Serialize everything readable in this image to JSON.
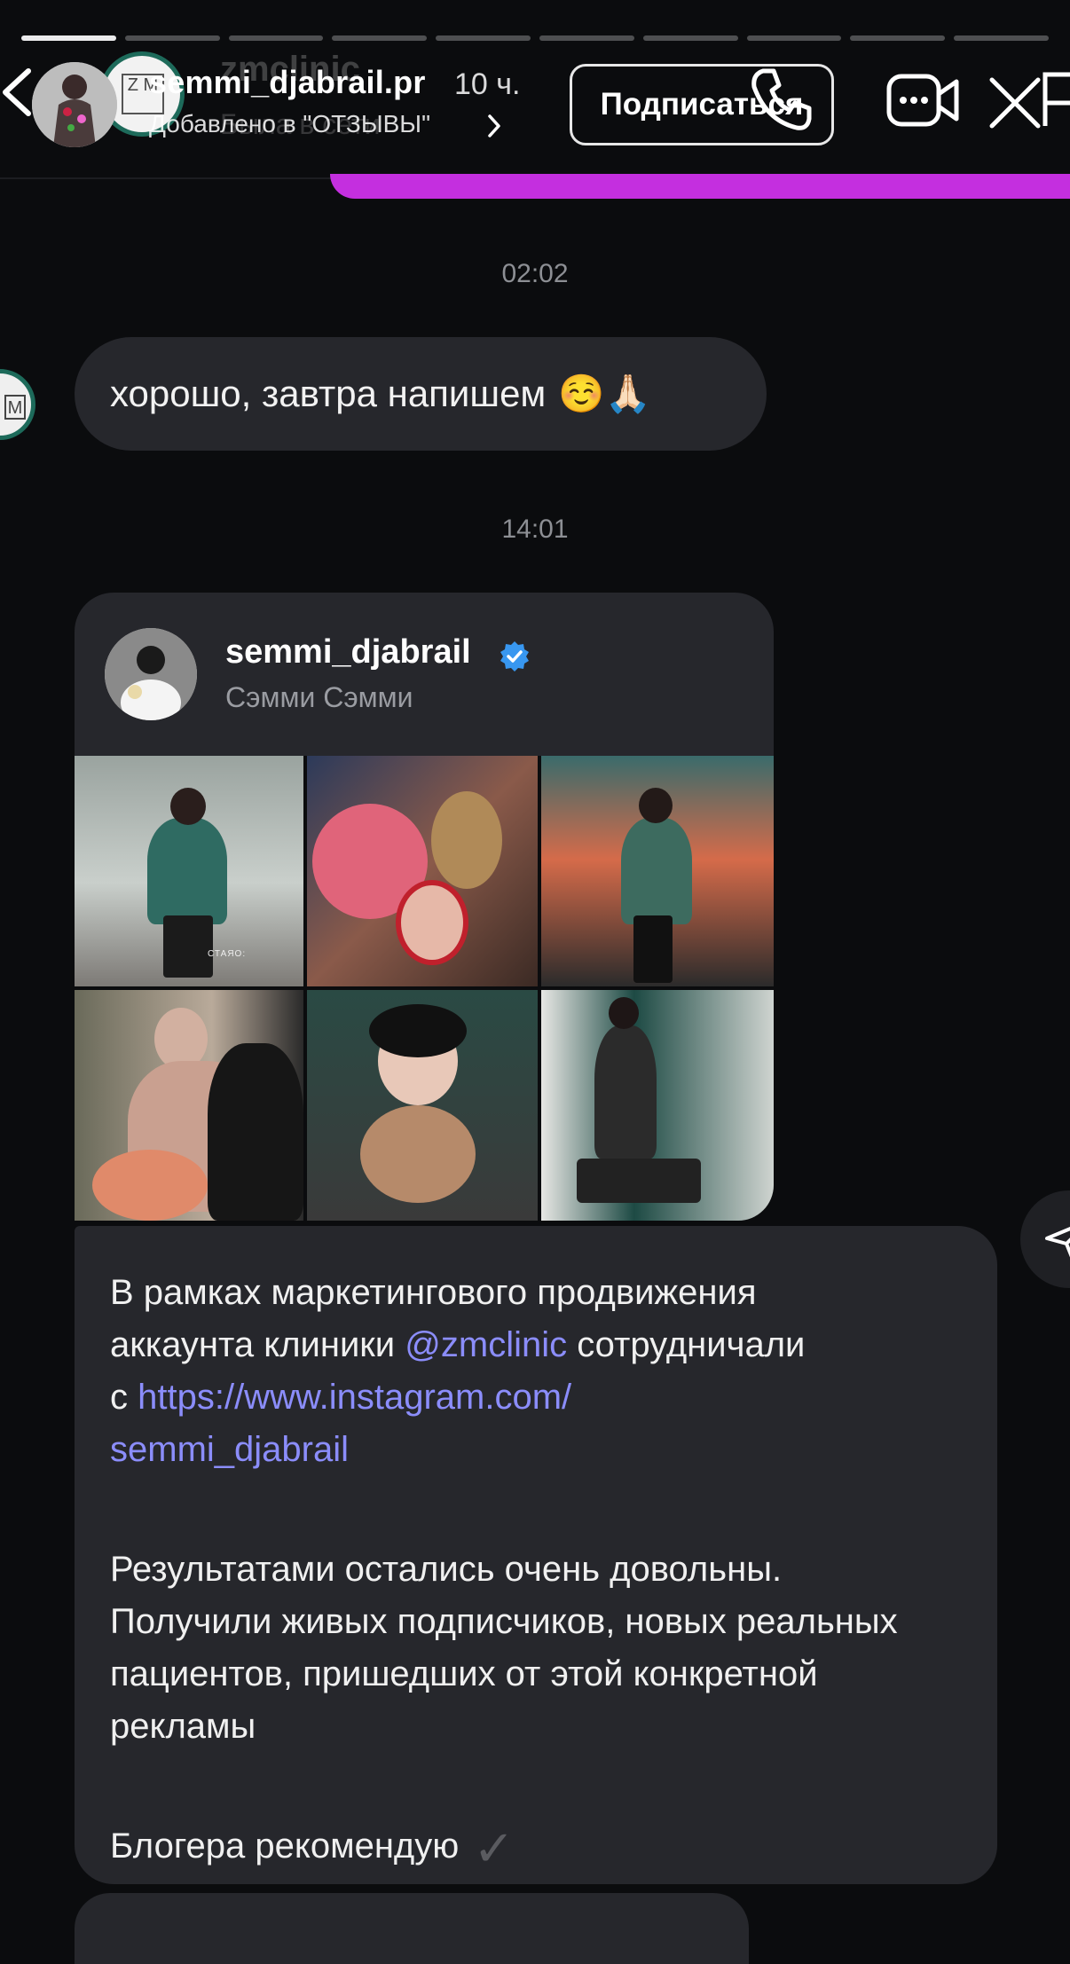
{
  "story": {
    "progress_segments": 10,
    "progress_done": 1
  },
  "header": {
    "username": "semmi_djabrail.pr",
    "time_ago": "10 ч.",
    "added_to": "Добавлено в \"ОТЗЫВЫ\"",
    "subscribe_label": "Подписаться",
    "ghost_name": "zmclinic",
    "ghost_sub": "Была в сети",
    "zm_logo_text": "Z M"
  },
  "chat": {
    "timestamp_1": "02:02",
    "message_1": "хорошо, завтра напишем",
    "message_1_emoji": "☺️🙏🏻",
    "timestamp_2": "14:01",
    "side_avatar_text": "M",
    "shared_post": {
      "username": "semmi_djabrail",
      "full_name": "Сэмми Сэмми",
      "tile_caption": "СТАЯО:"
    },
    "reply": {
      "line_1a": "В рамках маркетингового продвижения",
      "line_2a": "аккаунта клиники ",
      "mention": "@zmclinic",
      "line_2b": " сотрудничали",
      "line_3a": "с ",
      "link_1": "https://www.instagram.com/",
      "link_2": "semmi_djabrail",
      "para_2": "Результатами остались очень довольны. Получили живых подписчиков, новых реальных пациентов, пришедших от этой конкретной рекламы",
      "para_3": "Блогера рекомендую",
      "para_3_mark": "✓"
    }
  },
  "colors": {
    "accent_purple": "#c42fdf",
    "link": "#8b8dfb",
    "bubble": "#26272c",
    "verified": "#3897f0",
    "avatar_ring": "#1d6a5a"
  },
  "icons": [
    "chevron-left-icon",
    "chevron-right-icon",
    "phone-icon",
    "video-icon",
    "close-icon",
    "flag-icon",
    "verified-badge-icon",
    "share-icon"
  ]
}
